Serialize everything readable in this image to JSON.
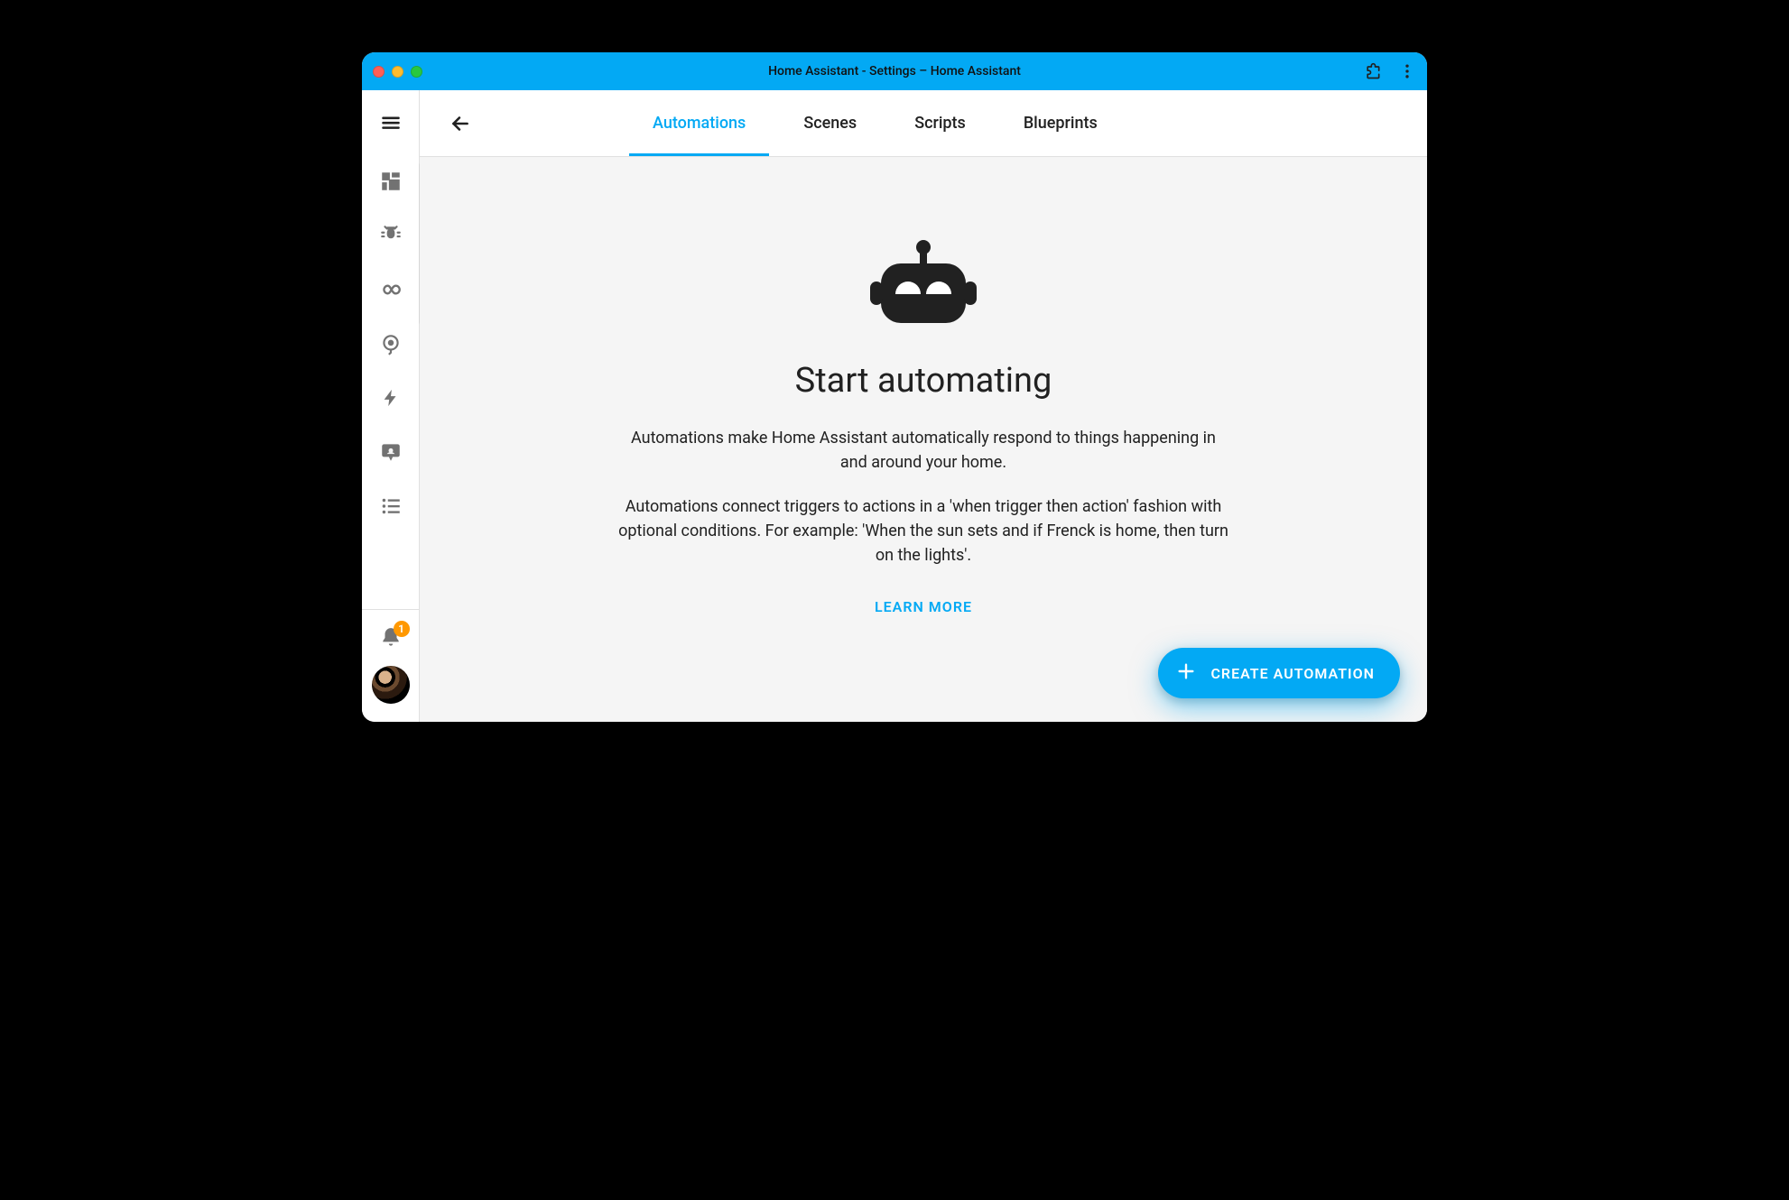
{
  "window": {
    "title": "Home Assistant - Settings – Home Assistant"
  },
  "sidebar": {
    "notifications_count": "1"
  },
  "tabs": [
    {
      "label": "Automations",
      "active": true
    },
    {
      "label": "Scenes",
      "active": false
    },
    {
      "label": "Scripts",
      "active": false
    },
    {
      "label": "Blueprints",
      "active": false
    }
  ],
  "empty_state": {
    "headline": "Start automating",
    "paragraph1": "Automations make Home Assistant automatically respond to things happening in and around your home.",
    "paragraph2": "Automations connect triggers to actions in a 'when trigger then action' fashion with optional conditions. For example: 'When the sun sets and if Frenck is home, then turn on the lights'.",
    "learn_more": "LEARN MORE"
  },
  "fab": {
    "label": "CREATE AUTOMATION"
  }
}
